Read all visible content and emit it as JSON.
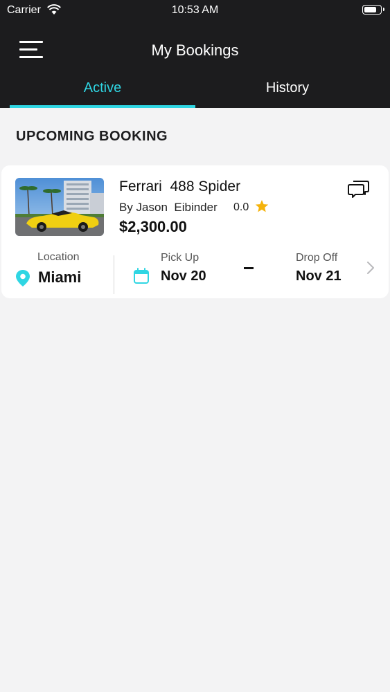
{
  "status_bar": {
    "carrier": "Carrier",
    "time": "10:53 AM",
    "icons": [
      "wifi-icon",
      "battery-icon"
    ]
  },
  "header": {
    "title": "My Bookings",
    "menu_icon": "hamburger-menu-icon"
  },
  "tabs": [
    {
      "label": "Active",
      "selected": true
    },
    {
      "label": "History",
      "selected": false
    }
  ],
  "section": {
    "title": "UPCOMING BOOKING"
  },
  "booking": {
    "car_name": "Ferrari  488 Spider",
    "owner": "By Jason  Eibinder",
    "rating": "0.0",
    "price": "$2,300.00",
    "location_label": "Location",
    "location": "Miami",
    "pickup_label": "Pick Up",
    "pickup": "Nov 20",
    "dropoff_label": "Drop Off",
    "dropoff": "Nov 21"
  },
  "colors": {
    "accent": "#2fd6e3",
    "header_bg": "#1c1c1e",
    "star": "#f5b30b",
    "background": "#f3f3f4"
  }
}
